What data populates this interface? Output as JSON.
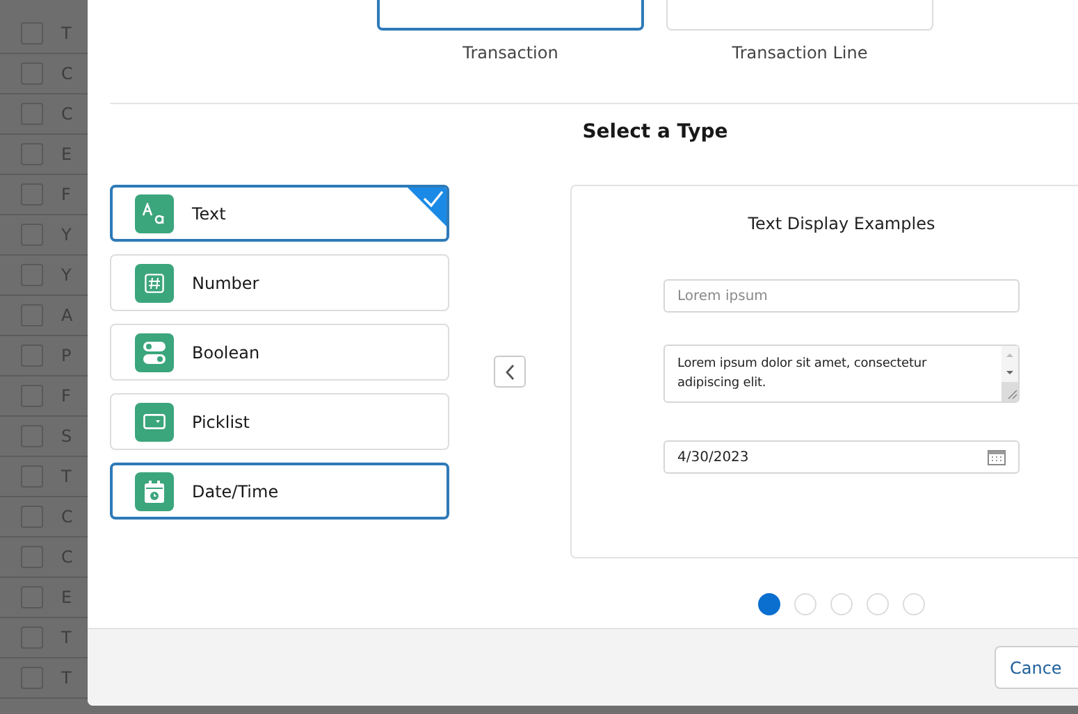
{
  "background_list": {
    "rows": [
      {
        "letter": "T",
        "checked": false
      },
      {
        "letter": "C",
        "checked": false
      },
      {
        "letter": "C",
        "checked": false
      },
      {
        "letter": "E",
        "checked": false
      },
      {
        "letter": "F",
        "checked": false
      },
      {
        "letter": "Y",
        "checked": false
      },
      {
        "letter": "Y",
        "checked": false
      },
      {
        "letter": "A",
        "checked": false
      },
      {
        "letter": "P",
        "checked": false
      },
      {
        "letter": "F",
        "checked": false
      },
      {
        "letter": "S",
        "checked": false
      },
      {
        "letter": "T",
        "checked": false
      },
      {
        "letter": "C",
        "checked": false
      },
      {
        "letter": "C",
        "checked": false
      },
      {
        "letter": "E",
        "checked": false
      },
      {
        "letter": "T",
        "checked": false
      },
      {
        "letter": "T",
        "checked": false
      }
    ]
  },
  "dialog": {
    "object_options": [
      {
        "label": "Transaction",
        "selected": true
      },
      {
        "label": "Transaction Line",
        "selected": false
      }
    ],
    "section_title": "Select a Type",
    "types": [
      {
        "label": "Text",
        "kind": "text",
        "selected": true,
        "focused": false
      },
      {
        "label": "Number",
        "kind": "number",
        "selected": false,
        "focused": false
      },
      {
        "label": "Boolean",
        "kind": "boolean",
        "selected": false,
        "focused": false
      },
      {
        "label": "Picklist",
        "kind": "picklist",
        "selected": false,
        "focused": false
      },
      {
        "label": "Date/Time",
        "kind": "datetime",
        "selected": false,
        "focused": true
      }
    ],
    "preview": {
      "title": "Text Display Examples",
      "input_placeholder": "Lorem ipsum",
      "textarea_value": "Lorem ipsum dolor sit amet, consectetur adipiscing elit.",
      "date_value": "4/30/2023"
    },
    "pager": [
      {
        "selected": true
      },
      {
        "selected": false
      },
      {
        "selected": false
      },
      {
        "selected": false
      },
      {
        "selected": false
      }
    ],
    "footer": {
      "cancel": "Cance"
    }
  }
}
